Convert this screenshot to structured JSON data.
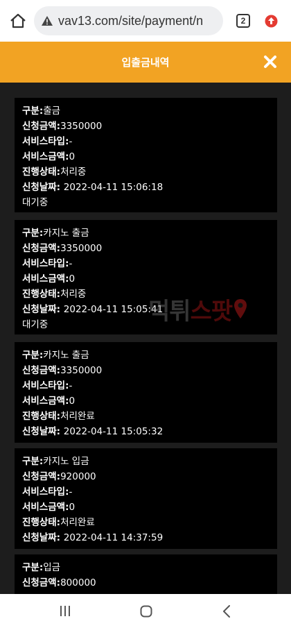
{
  "browser": {
    "url": "vav13.com/site/payment/n",
    "tab_count": "2"
  },
  "header": {
    "title": "입출금내역"
  },
  "labels": {
    "category": "구분:",
    "amount": "신청금액:",
    "service_type": "서비스타입:",
    "service_amount": "서비스금액:",
    "status": "진행상태:",
    "date": "신청날짜: "
  },
  "entries": [
    {
      "category": "출금",
      "amount": "3350000",
      "service_type": "-",
      "service_amount": "0",
      "status": "처리중",
      "date": "2022-04-11 15:06:18",
      "note": "대기중"
    },
    {
      "category": "카지노 출금",
      "amount": "3350000",
      "service_type": "-",
      "service_amount": "0",
      "status": "처리중",
      "date": "2022-04-11 15:05:41",
      "note": "대기중"
    },
    {
      "category": "카지노 출금",
      "amount": "3350000",
      "service_type": "-",
      "service_amount": "0",
      "status": "처리완료",
      "date": "2022-04-11 15:05:32",
      "note": ""
    },
    {
      "category": "카지노 입금",
      "amount": "920000",
      "service_type": "-",
      "service_amount": "0",
      "status": "처리완료",
      "date": "2022-04-11 14:37:59",
      "note": ""
    },
    {
      "category": "입금",
      "amount": "800000",
      "service_type": "",
      "service_amount": "",
      "status": "",
      "date": "",
      "note": ""
    }
  ],
  "watermark": {
    "part1": "먹튀",
    "part2": "스팟"
  },
  "colors": {
    "header_bg": "#f2a323",
    "list_bg": "#1d1d1d",
    "card_bg": "#000000",
    "text": "#ffffff"
  },
  "icons": {
    "home": "home-icon",
    "warning": "warning-icon",
    "upload": "upload-icon",
    "close": "close-icon",
    "recent": "recent-apps-icon",
    "nav_home": "nav-home-icon",
    "back": "back-icon"
  }
}
